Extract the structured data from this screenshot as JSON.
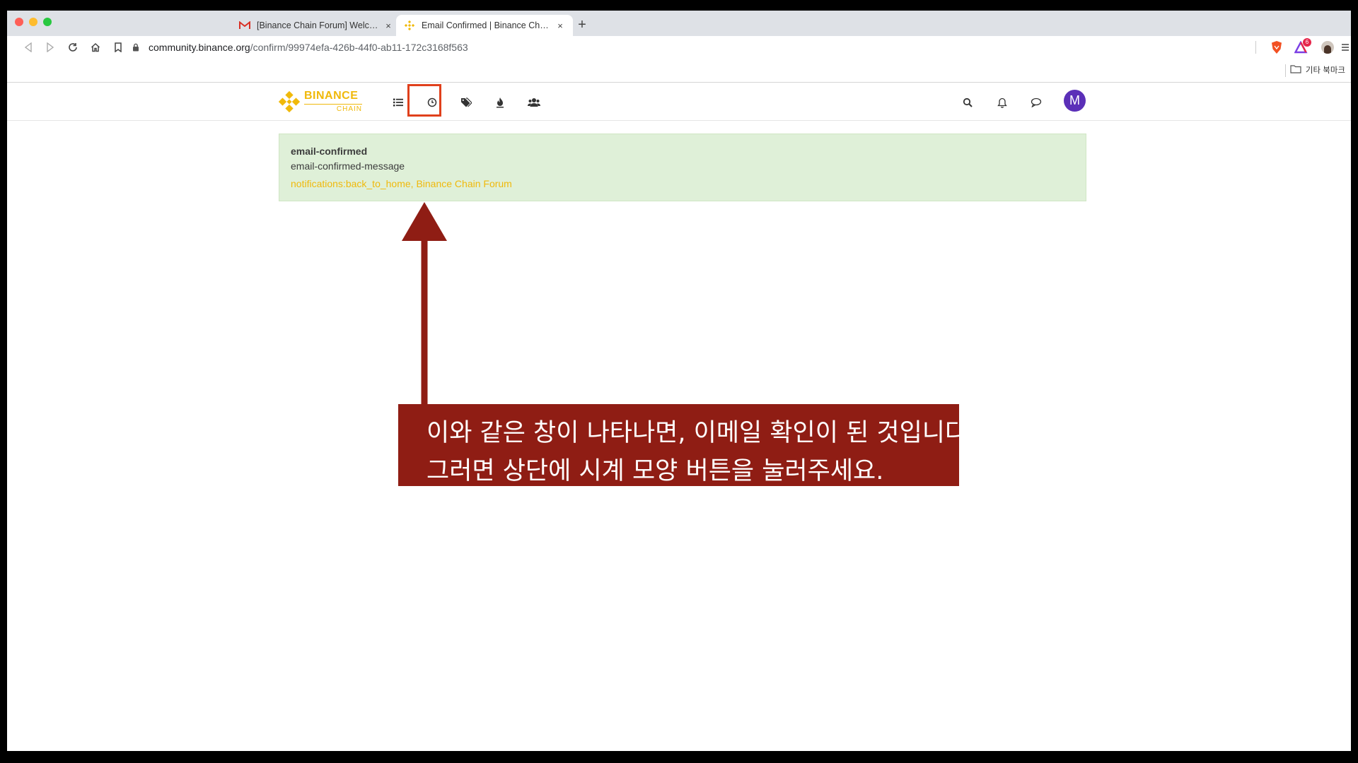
{
  "browser": {
    "tabs": [
      {
        "title": "[Binance Chain Forum] Welcome",
        "favicon": "gmail-icon",
        "active": false
      },
      {
        "title": "Email Confirmed | Binance Chain",
        "favicon": "binance-icon",
        "active": true
      }
    ],
    "new_tab_label": "+",
    "tab_close_label": "×",
    "url_host": "community.binance.org",
    "url_path": "/confirm/99974efa-426b-44f0-ab11-172c3168f563",
    "extension_badge": "6",
    "bookmarks": {
      "other_label": "기타 북마크"
    }
  },
  "site": {
    "logo": {
      "line1": "BINANCE",
      "line2": "CHAIN"
    },
    "nav_icons": [
      "list-icon",
      "recent-clock-icon",
      "tags-icon",
      "popular-fire-icon",
      "users-icon"
    ],
    "right_icons": [
      "search-icon",
      "bell-icon",
      "chat-icon"
    ],
    "avatar_letter": "M",
    "avatar_color": "#5b2fb8",
    "accent_color": "#f0b90b"
  },
  "alert": {
    "title": "email-confirmed",
    "message": "email-confirmed-message",
    "link": "notifications:back_to_home, Binance Chain Forum"
  },
  "annotation": {
    "line1": "이와 같은 창이 나타나면, 이메일 확인이 된 것입니다.",
    "line2": "그러면 상단에 시계 모양 버튼을 눌러주세요.",
    "color": "#8f1d14"
  }
}
